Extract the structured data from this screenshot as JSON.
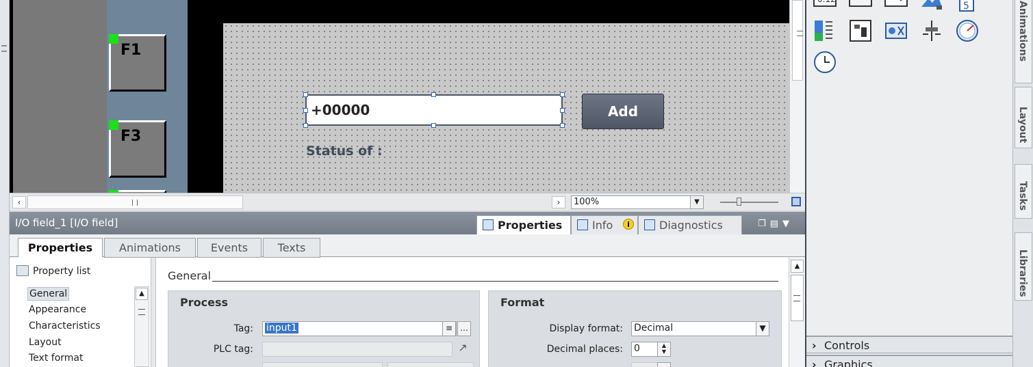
{
  "editor": {
    "function_keys": [
      "F1",
      "F3"
    ],
    "io_field_value": "+00000",
    "add_button_label": "Add",
    "status_label": "Status of :",
    "zoom_value": "100%"
  },
  "toolbox": {
    "icons": [
      "io-field-icon",
      "button-icon",
      "symbolic-io-icon",
      "graphic-view-icon",
      "clock-5-icon",
      "bar-icon",
      "switch-icon",
      "graphic-io-icon",
      "slider-icon",
      "gauge-icon",
      "clock-icon"
    ],
    "sections": [
      {
        "label": "Controls"
      },
      {
        "label": "Graphics"
      }
    ]
  },
  "side_tabs": [
    "Animations",
    "Layout",
    "Tasks",
    "Libraries"
  ],
  "inspector": {
    "title": "I/O field_1 [I/O field]",
    "header_tabs": [
      "Properties",
      "Info",
      "Diagnostics"
    ],
    "sub_tabs": [
      "Properties",
      "Animations",
      "Events",
      "Texts"
    ],
    "property_list_label": "Property list",
    "nav_items": [
      "General",
      "Appearance",
      "Characteristics",
      "Layout",
      "Text format"
    ],
    "section_title": "General",
    "process": {
      "title": "Process",
      "tag_label": "Tag:",
      "tag_value": "input1",
      "plc_tag_label": "PLC tag:",
      "plc_tag_value": ""
    },
    "format": {
      "title": "Format",
      "display_format_label": "Display format:",
      "display_format_value": "Decimal",
      "decimal_places_label": "Decimal places:",
      "decimal_places_value": "0"
    }
  }
}
